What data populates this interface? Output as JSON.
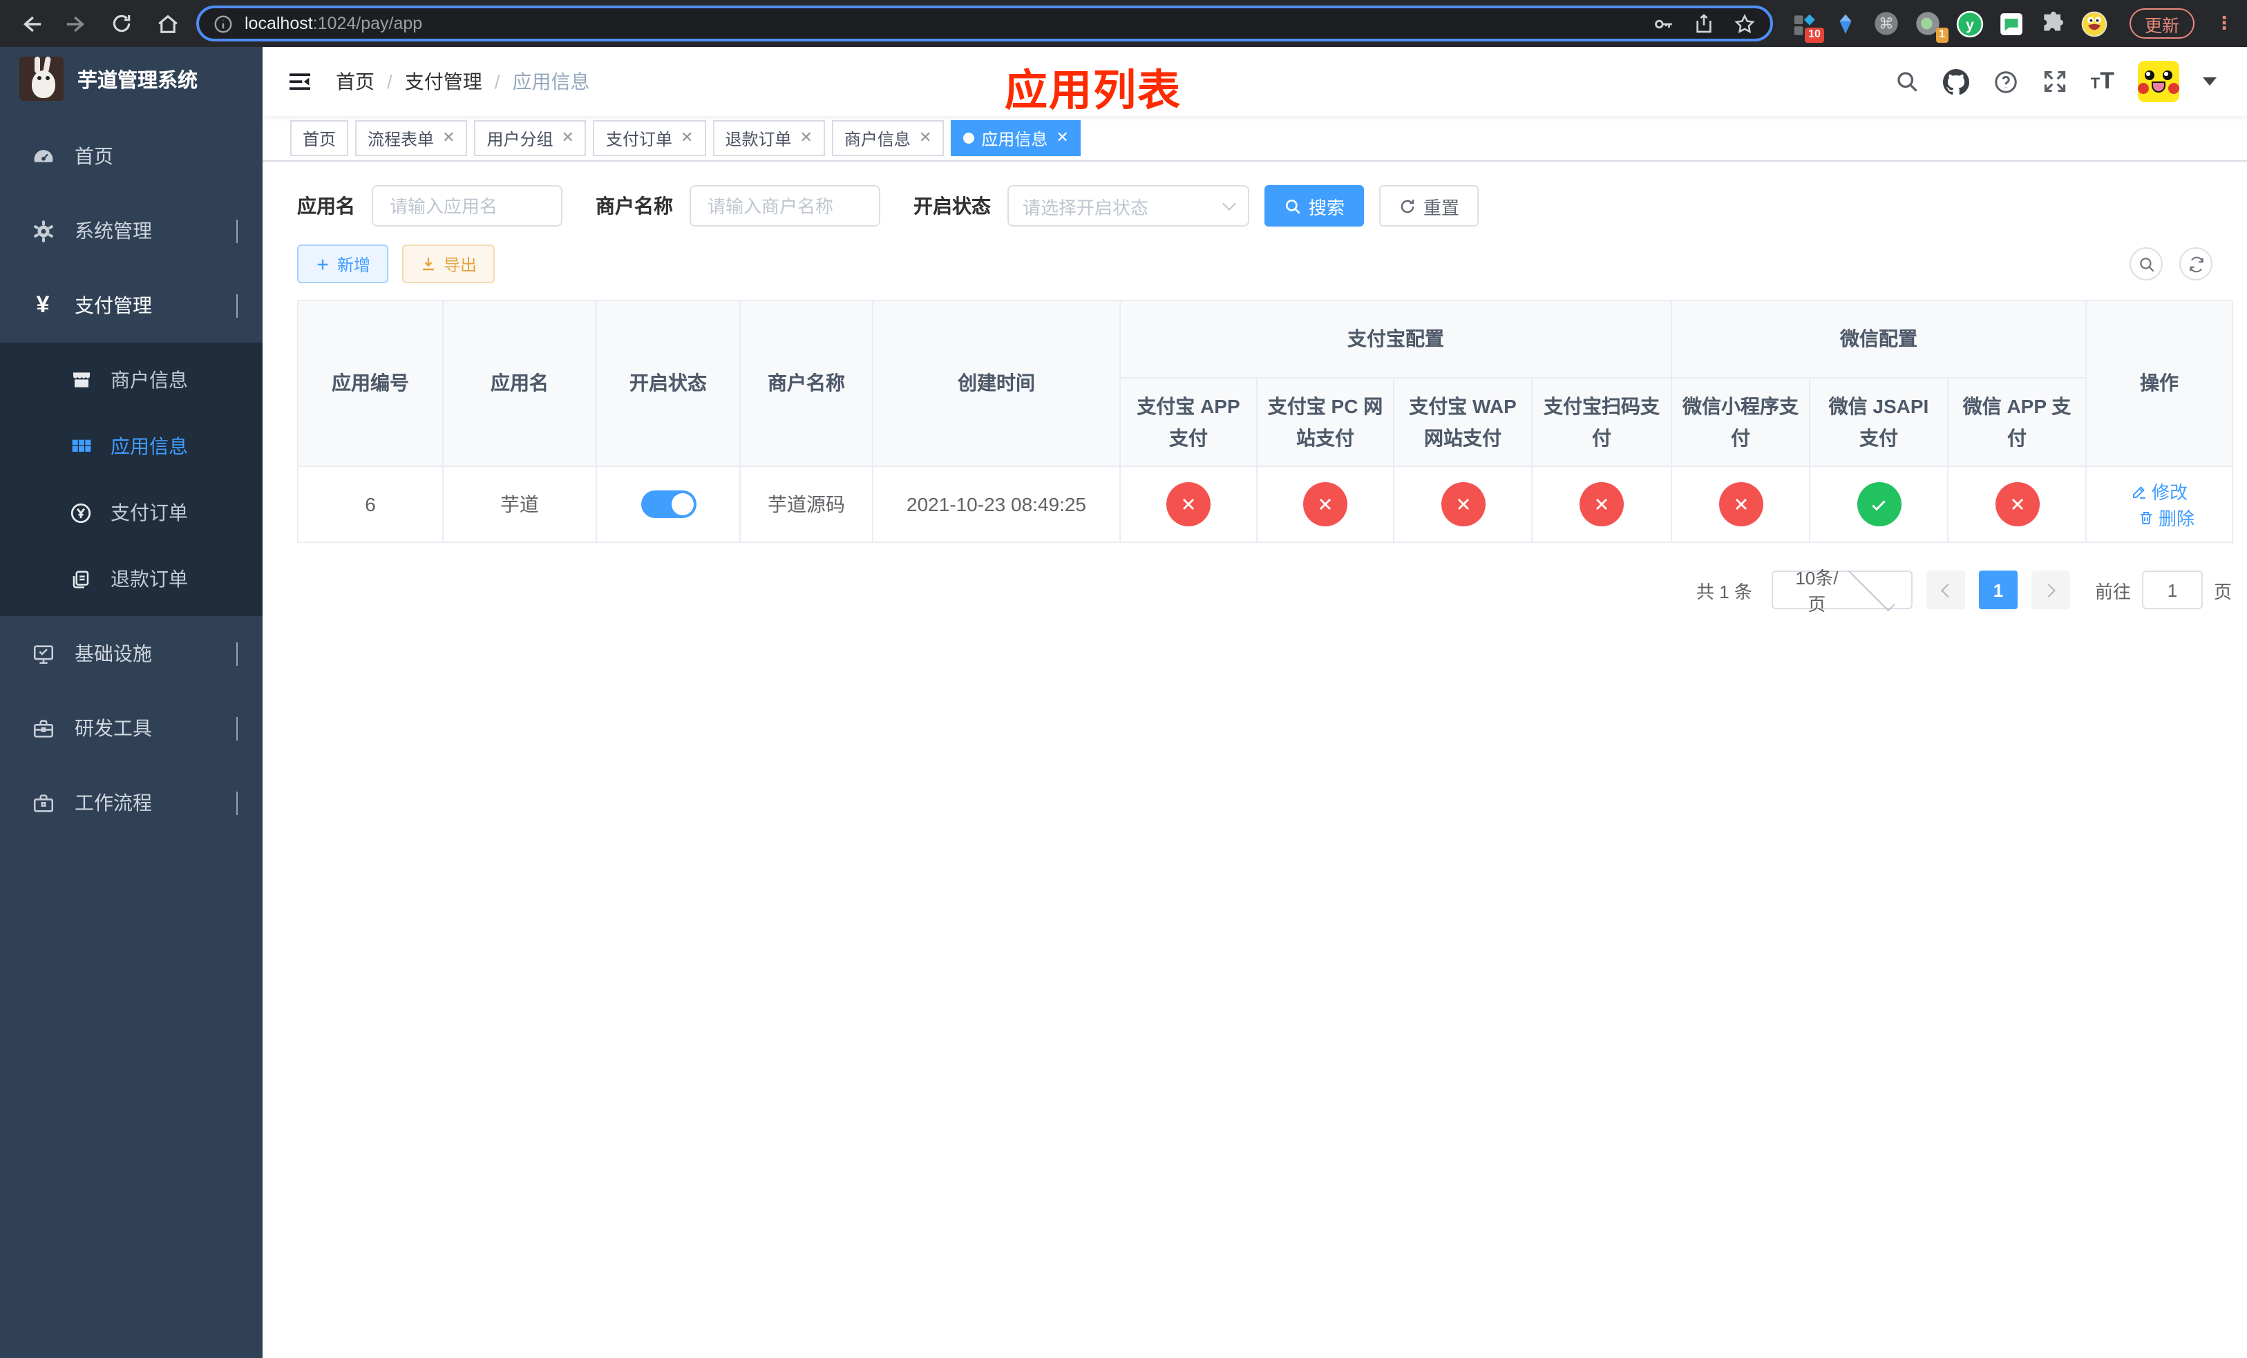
{
  "browser": {
    "url": {
      "host": "localhost",
      "rest": ":1024/pay/app"
    },
    "update_label": "更新",
    "ext_badge_blocks": "10",
    "ext_badge_circle": "1"
  },
  "sidebar": {
    "title": "芋道管理系统",
    "menu": {
      "home": "首页",
      "system": "系统管理",
      "payment": "支付管理",
      "infra": "基础设施",
      "devtools": "研发工具",
      "workflow": "工作流程"
    },
    "submenu": {
      "merchant": "商户信息",
      "app": "应用信息",
      "pay_order": "支付订单",
      "refund_order": "退款订单"
    }
  },
  "header": {
    "breadcrumb": [
      "首页",
      "支付管理",
      "应用信息"
    ],
    "annotation": "应用列表"
  },
  "tabs": [
    {
      "label": "首页"
    },
    {
      "label": "流程表单"
    },
    {
      "label": "用户分组"
    },
    {
      "label": "支付订单"
    },
    {
      "label": "退款订单"
    },
    {
      "label": "商户信息"
    },
    {
      "label": "应用信息"
    }
  ],
  "filters": {
    "app_name_label": "应用名",
    "app_name_placeholder": "请输入应用名",
    "merchant_label": "商户名称",
    "merchant_placeholder": "请输入商户名称",
    "status_label": "开启状态",
    "status_placeholder": "请选择开启状态",
    "search_label": "搜索",
    "reset_label": "重置"
  },
  "toolbar": {
    "add_label": "新增",
    "export_label": "导出"
  },
  "table": {
    "cols": {
      "app_id": "应用编号",
      "app_name": "应用名",
      "status": "开启状态",
      "merchant": "商户名称",
      "created": "创建时间",
      "actions": "操作"
    },
    "groups": {
      "alipay": "支付宝配置",
      "wechat": "微信配置"
    },
    "sub": [
      "支付宝 APP 支付",
      "支付宝 PC 网站支付",
      "支付宝 WAP 网站支付",
      "支付宝扫码支付",
      "微信小程序支付",
      "微信 JSAPI 支付",
      "微信 APP 支付"
    ],
    "rows": [
      {
        "app_id": "6",
        "app_name": "芋道",
        "enabled": true,
        "merchant": "芋道源码",
        "created": "2021-10-23 08:49:25",
        "payments": [
          false,
          false,
          false,
          false,
          false,
          true,
          false
        ],
        "edit_label": "修改",
        "delete_label": "删除"
      }
    ]
  },
  "pagination": {
    "total": "共 1 条",
    "page_size": "10条/页",
    "page": "1",
    "goto_label": "前往",
    "goto_value": "1",
    "unit": "页"
  },
  "icons": {
    "close": "✕"
  },
  "colors": {
    "primary": "#409EFF",
    "success": "#22c261",
    "danger": "#f4524e",
    "warning": "#e6a23c",
    "annotation": "#ff2b00"
  }
}
